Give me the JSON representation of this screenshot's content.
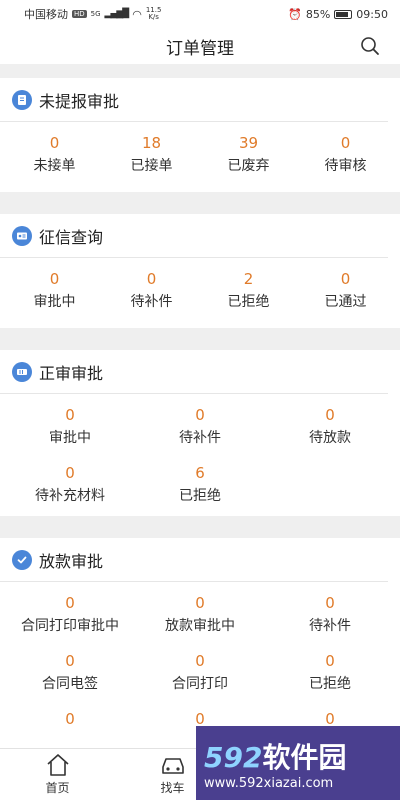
{
  "status_bar": {
    "carrier": "中国移动",
    "hd": "HD",
    "net": "5G",
    "speed_value": "11.5",
    "speed_unit": "K/s",
    "battery": "85%",
    "battery_level": 0.85,
    "time": "09:50"
  },
  "header": {
    "title": "订单管理"
  },
  "sections": [
    {
      "title": "未提报审批",
      "items": [
        {
          "value": "0",
          "label": "未接单"
        },
        {
          "value": "18",
          "label": "已接单"
        },
        {
          "value": "39",
          "label": "已废弃"
        },
        {
          "value": "0",
          "label": "待审核"
        }
      ]
    },
    {
      "title": "征信查询",
      "items": [
        {
          "value": "0",
          "label": "审批中"
        },
        {
          "value": "0",
          "label": "待补件"
        },
        {
          "value": "2",
          "label": "已拒绝"
        },
        {
          "value": "0",
          "label": "已通过"
        }
      ]
    },
    {
      "title": "正审审批",
      "items": [
        {
          "value": "0",
          "label": "审批中"
        },
        {
          "value": "0",
          "label": "待补件"
        },
        {
          "value": "0",
          "label": "待放款"
        },
        {
          "value": "0",
          "label": "待补充材料"
        },
        {
          "value": "6",
          "label": "已拒绝"
        }
      ]
    },
    {
      "title": "放款审批",
      "items": [
        {
          "value": "0",
          "label": "合同打印审批中"
        },
        {
          "value": "0",
          "label": "放款审批中"
        },
        {
          "value": "0",
          "label": "待补件"
        },
        {
          "value": "0",
          "label": "合同电签"
        },
        {
          "value": "0",
          "label": "合同打印"
        },
        {
          "value": "0",
          "label": "已拒绝"
        },
        {
          "value": "0",
          "label": ""
        },
        {
          "value": "0",
          "label": ""
        },
        {
          "value": "0",
          "label": ""
        }
      ]
    }
  ],
  "bottom_nav": [
    {
      "label": "首页",
      "icon": "home-icon"
    },
    {
      "label": "找车",
      "icon": "car-icon"
    }
  ],
  "watermark": {
    "digits": "592",
    "text": "软件园",
    "url": "www.592xiazai.com"
  },
  "colors": {
    "accent": "#e07b2a",
    "icon_blue": "#4a86d8"
  }
}
